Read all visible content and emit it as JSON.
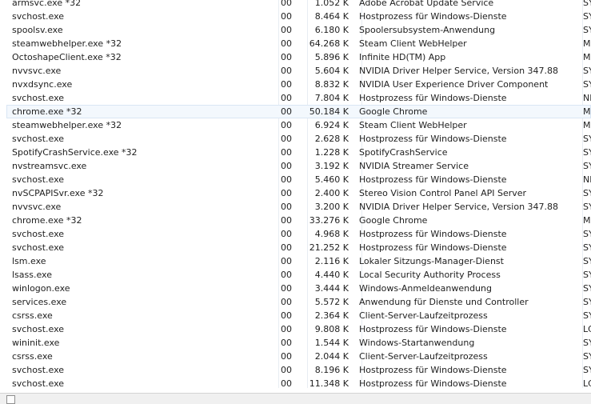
{
  "processes": [
    {
      "name": "armsvc.exe *32",
      "cpu": "00",
      "mem": "1.052 K",
      "desc": "Adobe Acrobat Update Service",
      "user": "SY"
    },
    {
      "name": "svchost.exe",
      "cpu": "00",
      "mem": "8.464 K",
      "desc": "Hostprozess für Windows-Dienste",
      "user": "SY"
    },
    {
      "name": "spoolsv.exe",
      "cpu": "00",
      "mem": "6.180 K",
      "desc": "Spoolersubsystem-Anwendung",
      "user": "SY"
    },
    {
      "name": "steamwebhelper.exe *32",
      "cpu": "00",
      "mem": "64.268 K",
      "desc": "Steam Client WebHelper",
      "user": "Mi"
    },
    {
      "name": "OctoshapeClient.exe *32",
      "cpu": "00",
      "mem": "5.896 K",
      "desc": "Infinite HD(TM) App",
      "user": "Mi"
    },
    {
      "name": "nvvsvc.exe",
      "cpu": "00",
      "mem": "5.604 K",
      "desc": "NVIDIA Driver Helper Service, Version 347.88",
      "user": "SY"
    },
    {
      "name": "nvxdsync.exe",
      "cpu": "00",
      "mem": "8.832 K",
      "desc": "NVIDIA User Experience Driver Component",
      "user": "SY"
    },
    {
      "name": "svchost.exe",
      "cpu": "00",
      "mem": "7.804 K",
      "desc": "Hostprozess für Windows-Dienste",
      "user": "NE"
    },
    {
      "name": "chrome.exe *32",
      "cpu": "00",
      "mem": "50.184 K",
      "desc": "Google Chrome",
      "user": "Mi"
    },
    {
      "name": "steamwebhelper.exe *32",
      "cpu": "00",
      "mem": "6.924 K",
      "desc": "Steam Client WebHelper",
      "user": "Mi"
    },
    {
      "name": "svchost.exe",
      "cpu": "00",
      "mem": "2.628 K",
      "desc": "Hostprozess für Windows-Dienste",
      "user": "SY"
    },
    {
      "name": "SpotifyCrashService.exe *32",
      "cpu": "00",
      "mem": "1.228 K",
      "desc": "SpotifyCrashService",
      "user": "SY"
    },
    {
      "name": "nvstreamsvc.exe",
      "cpu": "00",
      "mem": "3.192 K",
      "desc": "NVIDIA Streamer Service",
      "user": "SY"
    },
    {
      "name": "svchost.exe",
      "cpu": "00",
      "mem": "5.460 K",
      "desc": "Hostprozess für Windows-Dienste",
      "user": "NE"
    },
    {
      "name": "nvSCPAPISvr.exe *32",
      "cpu": "00",
      "mem": "2.400 K",
      "desc": "Stereo Vision Control Panel API Server",
      "user": "SY"
    },
    {
      "name": "nvvsvc.exe",
      "cpu": "00",
      "mem": "3.200 K",
      "desc": "NVIDIA Driver Helper Service, Version 347.88",
      "user": "SY"
    },
    {
      "name": "chrome.exe *32",
      "cpu": "00",
      "mem": "33.276 K",
      "desc": "Google Chrome",
      "user": "Mi"
    },
    {
      "name": "svchost.exe",
      "cpu": "00",
      "mem": "4.968 K",
      "desc": "Hostprozess für Windows-Dienste",
      "user": "SY"
    },
    {
      "name": "svchost.exe",
      "cpu": "00",
      "mem": "21.252 K",
      "desc": "Hostprozess für Windows-Dienste",
      "user": "SY"
    },
    {
      "name": "lsm.exe",
      "cpu": "00",
      "mem": "2.116 K",
      "desc": "Lokaler Sitzungs-Manager-Dienst",
      "user": "SY"
    },
    {
      "name": "lsass.exe",
      "cpu": "00",
      "mem": "4.440 K",
      "desc": "Local Security Authority Process",
      "user": "SY"
    },
    {
      "name": "winlogon.exe",
      "cpu": "00",
      "mem": "3.444 K",
      "desc": "Windows-Anmeldeanwendung",
      "user": "SY"
    },
    {
      "name": "services.exe",
      "cpu": "00",
      "mem": "5.572 K",
      "desc": "Anwendung für Dienste und Controller",
      "user": "SY"
    },
    {
      "name": "csrss.exe",
      "cpu": "00",
      "mem": "2.364 K",
      "desc": "Client-Server-Laufzeitprozess",
      "user": "SY"
    },
    {
      "name": "svchost.exe",
      "cpu": "00",
      "mem": "9.808 K",
      "desc": "Hostprozess für Windows-Dienste",
      "user": "LC"
    },
    {
      "name": "wininit.exe",
      "cpu": "00",
      "mem": "1.544 K",
      "desc": "Windows-Startanwendung",
      "user": "SY"
    },
    {
      "name": "csrss.exe",
      "cpu": "00",
      "mem": "2.044 K",
      "desc": "Client-Server-Laufzeitprozess",
      "user": "SY"
    },
    {
      "name": "svchost.exe",
      "cpu": "00",
      "mem": "8.196 K",
      "desc": "Hostprozess für Windows-Dienste",
      "user": "SY"
    },
    {
      "name": "svchost.exe",
      "cpu": "00",
      "mem": "11.348 K",
      "desc": "Hostprozess für Windows-Dienste",
      "user": "LC"
    }
  ]
}
